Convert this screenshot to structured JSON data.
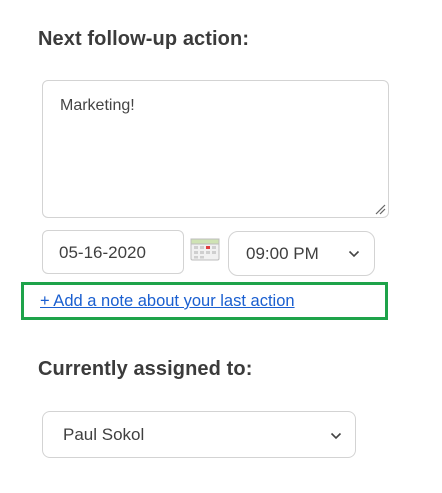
{
  "followup": {
    "heading": "Next follow-up action:",
    "note_text": "Marketing!",
    "date_value": "05-16-2020",
    "time_value": "09:00 PM",
    "add_note_link": "+ Add a note about your last action"
  },
  "assignment": {
    "heading": "Currently assigned to:",
    "assignee_value": "Paul Sokol"
  },
  "colors": {
    "link": "#1a5fd0",
    "highlight_border": "#1ea34a",
    "input_border": "#d3d3d3"
  }
}
